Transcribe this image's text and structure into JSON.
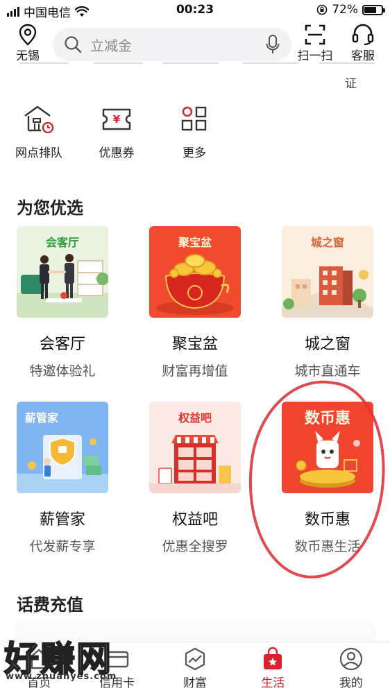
{
  "status_bar": {
    "carrier": "中国电信",
    "time": "00:23",
    "battery": "72%",
    "battery_level": 0.72
  },
  "top_bar": {
    "location": "无锡",
    "search_placeholder": "立减金",
    "scan_label": "扫一扫",
    "service_label": "客服"
  },
  "partial_row": {
    "tail_text": "证"
  },
  "quick_actions": [
    {
      "label": "网点排队",
      "icon": "branch-queue-icon"
    },
    {
      "label": "优惠券",
      "icon": "coupon-icon"
    },
    {
      "label": "更多",
      "icon": "more-grid-icon"
    }
  ],
  "recommended": {
    "title": "为您优选",
    "cards": [
      {
        "thumb_title": "会客厅",
        "name": "会客厅",
        "sub": "特邀体验礼",
        "bg": "#e9f3df",
        "title_color": "#2f9a3a"
      },
      {
        "thumb_title": "聚宝盆",
        "name": "聚宝盆",
        "sub": "财富再增值",
        "bg": "#f24a2e",
        "title_color": "#fff4d0"
      },
      {
        "thumb_title": "城之窗",
        "name": "城之窗",
        "sub": "城市直通车",
        "bg": "#fbeede",
        "title_color": "#e0623a"
      },
      {
        "thumb_title": "薪管家",
        "name": "薪管家",
        "sub": "代发薪专享",
        "bg": "#7fb6f2",
        "title_color": "#ffffff"
      },
      {
        "thumb_title": "权益吧",
        "name": "权益吧",
        "sub": "优惠全搜罗",
        "bg": "#fbe9e4",
        "title_color": "#e0352b"
      },
      {
        "thumb_title": "数币惠",
        "name": "数币惠",
        "sub": "数币惠生活",
        "bg": "#f0442f",
        "title_color": "#fff7e0"
      }
    ]
  },
  "recharge": {
    "title": "话费充值"
  },
  "tab_bar": {
    "tabs": [
      {
        "label": "首页",
        "icon": "home-icon"
      },
      {
        "label": "信用卡",
        "icon": "credit-card-icon"
      },
      {
        "label": "财富",
        "icon": "wealth-chart-icon"
      },
      {
        "label": "生活",
        "icon": "life-bag-icon",
        "active": true
      },
      {
        "label": "我的",
        "icon": "profile-icon"
      }
    ]
  },
  "watermark": {
    "text": "好赚网",
    "url": "www.zhuanyes.com"
  },
  "colors": {
    "accent": "#d8232f",
    "annotation_ring": "#e0333d"
  }
}
